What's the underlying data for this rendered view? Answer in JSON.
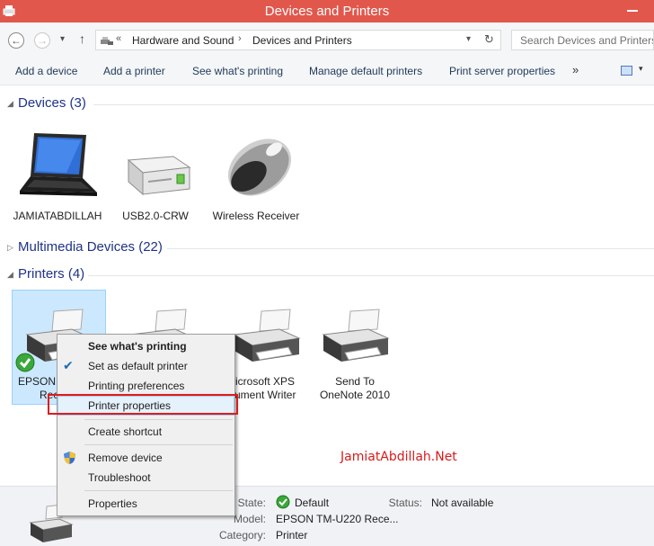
{
  "window": {
    "title": "Devices and Printers"
  },
  "address": {
    "overflow": "«",
    "crumbs": [
      "Hardware and Sound",
      "Devices and Printers"
    ],
    "search_placeholder": "Search Devices and Printers"
  },
  "commands": [
    "Add a device",
    "Add a printer",
    "See what's printing",
    "Manage default printers",
    "Print server properties",
    "»"
  ],
  "groups": {
    "devices": "Devices (3)",
    "multimedia": "Multimedia Devices (22)",
    "printers": "Printers (4)"
  },
  "devices": [
    {
      "name": "JAMIATABDILLAH",
      "icon": "laptop-icon"
    },
    {
      "name": "USB2.0-CRW",
      "icon": "drive-icon"
    },
    {
      "name": "Wireless Receiver",
      "icon": "mouse-icon"
    }
  ],
  "printers": [
    {
      "name": "EPSON T",
      "name2": "Rec",
      "default": true
    },
    {
      "name": "",
      "name2": ""
    },
    {
      "name": "icrosoft XPS",
      "name2": "ument Writer"
    },
    {
      "name": "Send To",
      "name2": "OneNote 2010"
    }
  ],
  "context_menu": {
    "items": [
      "See what's printing",
      "Set as default printer",
      "Printing preferences",
      "Printer properties",
      "Create shortcut",
      "Remove device",
      "Troubleshoot",
      "Properties"
    ]
  },
  "watermark": "JamiatAbdillah.Net",
  "details": {
    "state_label": "State:",
    "state_value": "Default",
    "status_label": "Status:",
    "status_value": "Not available",
    "model_label": "Model:",
    "model_value": "EPSON TM-U220 Rece...",
    "category_label": "Category:",
    "category_value": "Printer"
  },
  "colors": {
    "titlebar": "#e2574c",
    "group_header": "#1e3287",
    "highlight_box": "#e01b1b",
    "watermark": "#d91b1b"
  }
}
